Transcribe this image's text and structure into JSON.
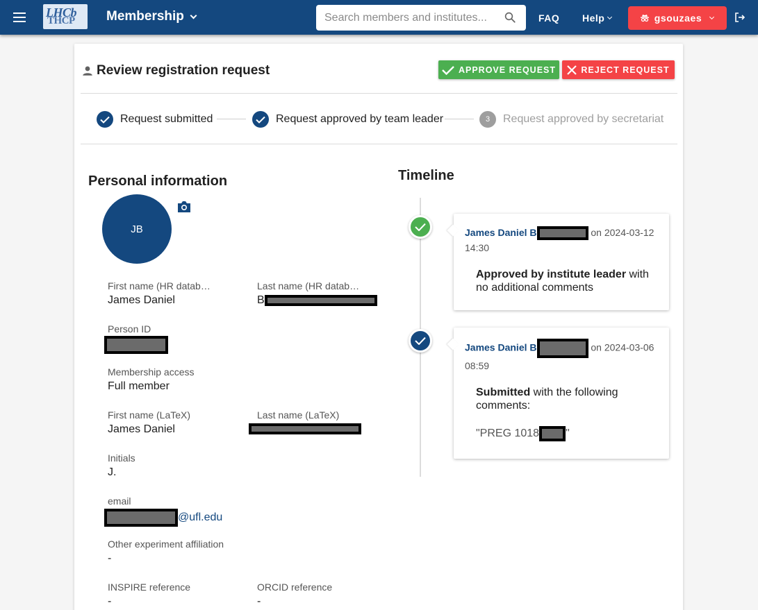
{
  "header": {
    "logo_text_top": "LHCb",
    "logo_text_bottom": "THCP",
    "brand": "Membership",
    "search_placeholder": "Search members and institutes...",
    "faq": "FAQ",
    "help": "Help",
    "user": "gsouzaes",
    "colors": {
      "bar": "#14487f",
      "user_button": "#f44346"
    }
  },
  "page": {
    "title": "Review registration request",
    "approve_label": "APPROVE REQUEST",
    "reject_label": "REJECT REQUEST"
  },
  "steps": [
    {
      "label": "Request submitted",
      "state": "complete"
    },
    {
      "label": "Request approved by team leader",
      "state": "complete"
    },
    {
      "label": "Request approved by secretariat",
      "state": "pending",
      "number": "3"
    }
  ],
  "personal": {
    "title": "Personal information",
    "initials_avatar": "JB",
    "fields": {
      "first_name_hr": {
        "label": "First name (HR datab…",
        "value": "James Daniel"
      },
      "last_name_hr": {
        "label": "Last name (HR datab…",
        "value": "B"
      },
      "person_id": {
        "label": "Person ID",
        "value": ""
      },
      "membership_access": {
        "label": "Membership access",
        "value": "Full member"
      },
      "first_name_latex": {
        "label": "First name (LaTeX)",
        "value": "James Daniel"
      },
      "last_name_latex": {
        "label": "Last name (LaTeX)",
        "value": ""
      },
      "initials": {
        "label": "Initials",
        "value": "J."
      },
      "email": {
        "label": "email",
        "value": "@ufl.edu"
      },
      "other_affiliation": {
        "label": "Other experiment affiliation",
        "value": "-"
      },
      "inspire": {
        "label": "INSPIRE reference",
        "value": "-"
      },
      "orcid": {
        "label": "ORCID reference",
        "value": "-"
      }
    }
  },
  "timeline": {
    "title": "Timeline",
    "entries": [
      {
        "author": "James Daniel B",
        "date_text": "on 2024-03-12",
        "time": "14:30",
        "action": "Approved by institute leader",
        "rest": " with no additional comments",
        "icon": "check-green",
        "color": "#4caf50"
      },
      {
        "author": "James Daniel B",
        "date_text": "on 2024-03-06",
        "time": "08:59",
        "action": "Submitted",
        "rest": " with the following comments:",
        "quote_start": "\"PREG 1018",
        "quote_end": "\"",
        "icon": "check-blue",
        "color": "#14487f"
      }
    ]
  }
}
